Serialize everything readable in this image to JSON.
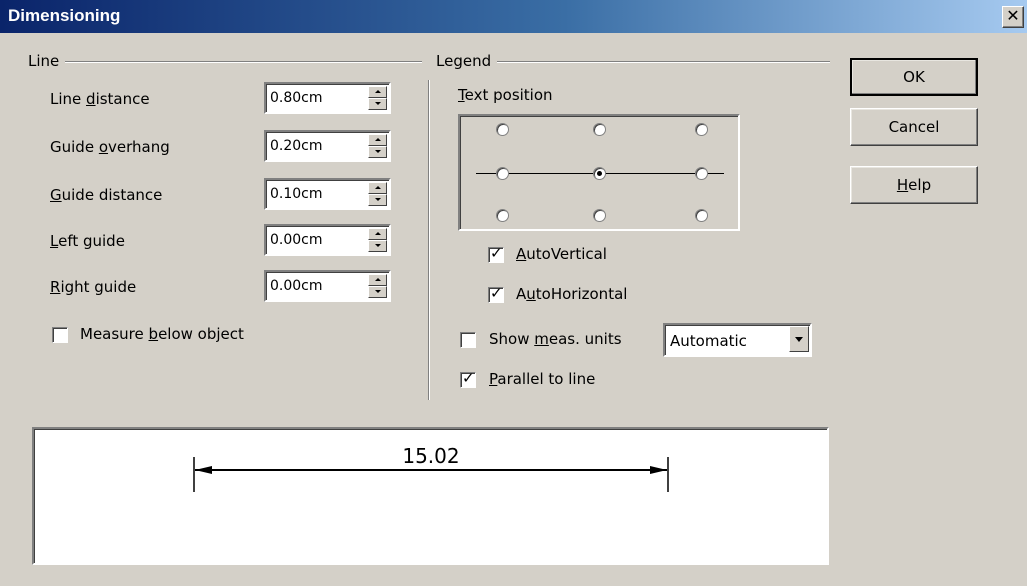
{
  "window": {
    "title": "Dimensioning",
    "close_glyph": "✕"
  },
  "line_group": {
    "label": "Line",
    "fields": [
      {
        "key": "line_distance",
        "pre": "Line ",
        "ul": "d",
        "post": "istance",
        "value": "0.80cm"
      },
      {
        "key": "guide_overhang",
        "pre": "Guide ",
        "ul": "o",
        "post": "verhang",
        "value": "0.20cm"
      },
      {
        "key": "guide_distance",
        "pre": "",
        "ul": "G",
        "post": "uide distance",
        "value": "0.10cm"
      },
      {
        "key": "left_guide",
        "pre": "",
        "ul": "L",
        "post": "eft guide",
        "value": "0.00cm"
      },
      {
        "key": "right_guide",
        "pre": "",
        "ul": "R",
        "post": "ight guide",
        "value": "0.00cm"
      }
    ],
    "measure_below": {
      "pre": "Measure ",
      "ul": "b",
      "post": "elow object",
      "checked": false
    }
  },
  "legend_group": {
    "label": "Legend",
    "text_position": {
      "pre": "",
      "ul": "T",
      "post": "ext position",
      "selected_row": 1,
      "selected_col": 1
    },
    "auto_vertical": {
      "pre": "",
      "ul": "A",
      "post": "utoVertical",
      "checked": true
    },
    "auto_horizontal": {
      "pre": "A",
      "ul": "u",
      "post": "toHorizontal",
      "checked": true
    },
    "show_units": {
      "pre": "Show ",
      "ul": "m",
      "post": "eas. units",
      "checked": false
    },
    "units_select": {
      "value": "Automatic"
    },
    "parallel": {
      "pre": "",
      "ul": "P",
      "post": "arallel to line",
      "checked": true
    }
  },
  "buttons": {
    "ok": "OK",
    "cancel": "Cancel",
    "help": {
      "pre": "",
      "ul": "H",
      "post": "elp"
    }
  },
  "preview": {
    "measurement": "15.02"
  },
  "icons": {
    "spin_up": "triangle-up",
    "spin_down": "triangle-down",
    "dropdown": "triangle-down",
    "checkmark": "check"
  }
}
